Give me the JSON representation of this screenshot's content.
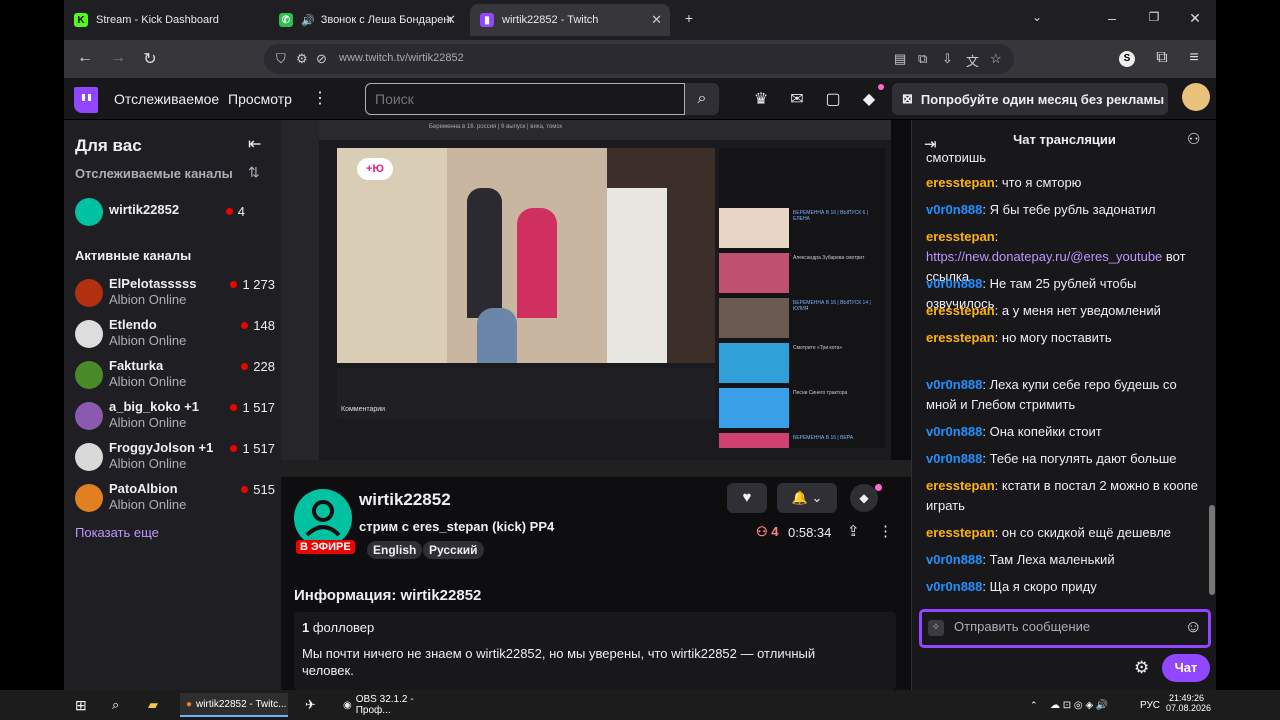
{
  "tabs": [
    {
      "title": "Stream - Kick Dashboard",
      "icon": "kick-icon"
    },
    {
      "title": "Звонок с Леша Бондаренко ZET",
      "icon": "phone-icon"
    },
    {
      "title": "wirtik22852 - Twitch",
      "icon": "twitch-icon"
    }
  ],
  "url": "www.twitch.tv/wirtik22852",
  "topbar": {
    "following": "Отслеживаемое",
    "browse": "Просмотр",
    "search_placeholder": "Поиск",
    "promo": "Попробуйте один месяц без рекламы"
  },
  "sidebar": {
    "for_you": "Для вас",
    "followed": "Отслеживаемые каналы",
    "followed_channel": {
      "name": "wirtik22852",
      "viewers": "4"
    },
    "active": "Активные каналы",
    "channels": [
      {
        "name": "ElPelotasssss",
        "game": "Albion Online",
        "viewers": "1 273",
        "color": "#b03010"
      },
      {
        "name": "Etlendo",
        "game": "Albion Online",
        "viewers": "148",
        "color": "#dddddd"
      },
      {
        "name": "Fakturka",
        "game": "Albion Online",
        "viewers": "228",
        "color": "#4a8a2a"
      },
      {
        "name": "a_big_koko +1",
        "game": "Albion Online",
        "viewers": "1 517",
        "color": "#8a5ab0"
      },
      {
        "name": "FroggyJolson +1",
        "game": "Albion Online",
        "viewers": "1 517",
        "color": "#d9d9d9"
      },
      {
        "name": "PatoAlbion",
        "game": "Albion Online",
        "viewers": "515",
        "color": "#e08020"
      }
    ],
    "show_more": "Показать еще"
  },
  "player": {
    "video_title": "Беременна в 16. россия | 6 выпуск | вика, томск",
    "suggest1": "БЕРЕМЕННА В 16 | ВЫПУСК 6 | ЕЛЕНА",
    "suggest2": "Александра Зубарева смотрит",
    "suggest3": "БЕРЕМЕННА В 16 | ВЫПУСК 14 | ЮЛИЯ",
    "suggest4": "Смотрите «Три кота»",
    "suggest5": "Песни Синего трактора",
    "suggest6": "БЕРЕМЕННА В 16 | ВЕРА",
    "comments": "Комментарии",
    "yt_badge": "+Ю"
  },
  "stream": {
    "channel": "wirtik22852",
    "title": "стрим с eres_stepan (kick) PP4",
    "live": "В ЭФИРЕ",
    "tags": [
      "English",
      "Русский"
    ],
    "viewers": "4",
    "uptime": "0:58:34",
    "about_label": "Информация: wirtik22852",
    "followers_count": "1",
    "followers_label": "фолловер",
    "bio": "Мы почти ничего не знаем о wirtik22852, но мы уверены, что wirtik22852 — отличный человек."
  },
  "chat": {
    "header": "Чат трансляции",
    "top_fragment": "смотришь",
    "input_placeholder": "Отправить сообщение",
    "send": "Чат",
    "messages": [
      {
        "user": "eresstepan",
        "text": "что я смторю"
      },
      {
        "user": "v0r0n888",
        "text": "Я бы тебе рубль задонатил"
      },
      {
        "user": "eresstepan",
        "link": "https://new.donatepay.ru/@eres_youtube",
        "text": " вот ссылка"
      },
      {
        "user": "v0r0n888",
        "text": "Не там 25 рублей чтобы озвучилось"
      },
      {
        "user": "eresstepan",
        "text": "а у меня нет уведомлений"
      },
      {
        "user": "eresstepan",
        "text": "но могу поставить"
      },
      {
        "user": "v0r0n888",
        "text": "Леха купи себе геро будешь со мной и Глебом стримить"
      },
      {
        "user": "v0r0n888",
        "text": "Она копейки стоит"
      },
      {
        "user": "v0r0n888",
        "text": "Тебе на погулять дают больше"
      },
      {
        "user": "eresstepan",
        "text": "кстати в постал 2 можно в коопе играть"
      },
      {
        "user": "eresstepan",
        "text": "он со скидкой ещё дешевле"
      },
      {
        "user": "v0r0n888",
        "text": "Там Леха маленький"
      },
      {
        "user": "v0r0n888",
        "text": "Ща я скоро приду"
      }
    ]
  },
  "taskbar": {
    "item1": "wirtik22852 - Twitc...",
    "item2": "OBS 32.1.2 - Проф...",
    "lang": "РУС",
    "time": "21:49:26",
    "date": "07.08.2026"
  }
}
